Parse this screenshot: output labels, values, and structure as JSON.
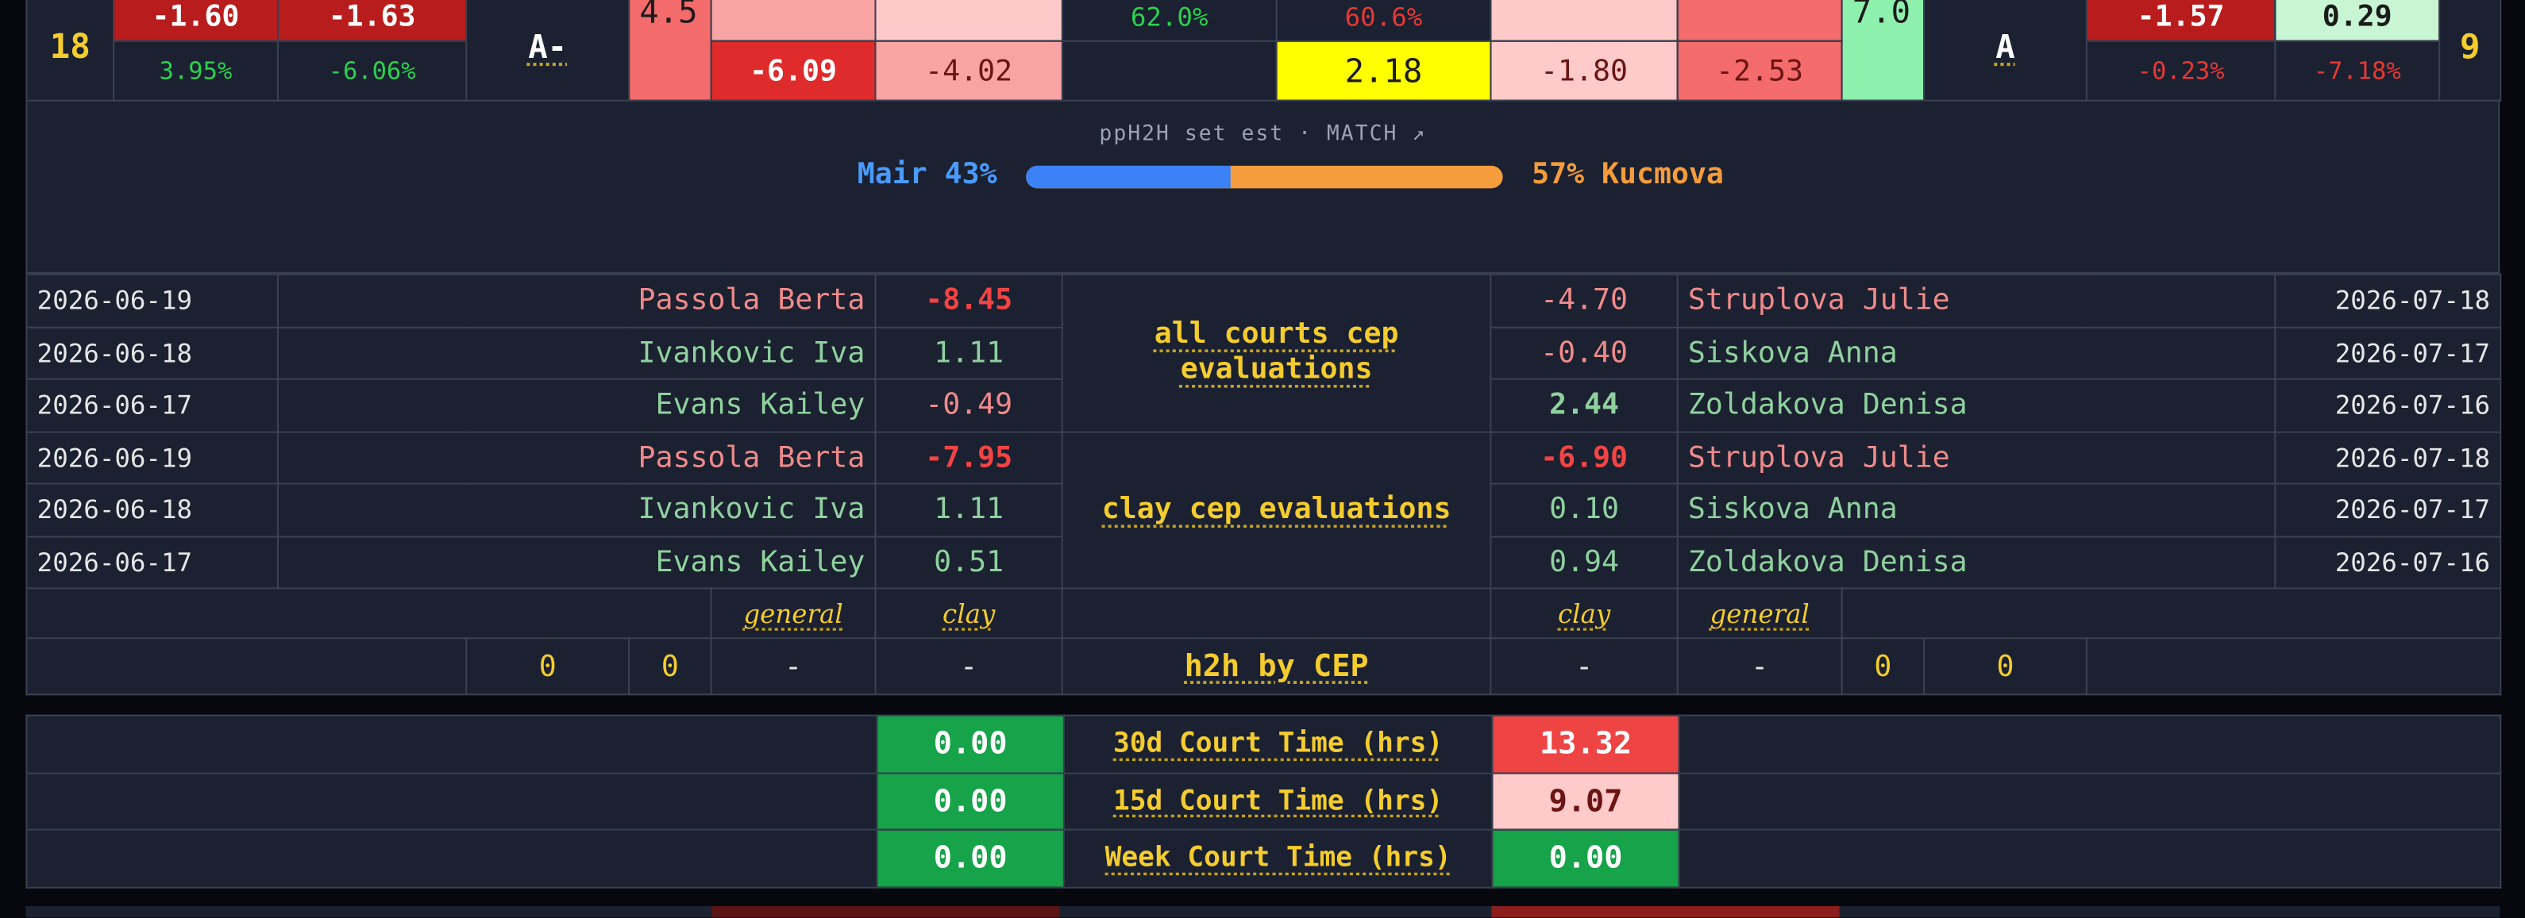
{
  "top": {
    "left_rank": "18",
    "left_vals": [
      "-1.60",
      "-1.63"
    ],
    "left_pcts": [
      "3.95%",
      "-6.06%"
    ],
    "left_grade": "A-",
    "left_score": "4.5",
    "mid_left_vals": [
      "-6.09",
      "-4.02"
    ],
    "center_pct_left": "62.0%",
    "center_pct_right": "60.6%",
    "center_big": "2.18",
    "mid_right_vals": [
      "-1.80",
      "-2.53"
    ],
    "right_score": "7.0",
    "right_grade": "A",
    "right_vals": [
      "-1.57",
      "0.29"
    ],
    "right_pcts": [
      "-0.23%",
      "-7.18%"
    ],
    "right_rank": "9"
  },
  "match": {
    "header": "ppH2H set est · MATCH ↗",
    "left_label": "Mair 43%",
    "right_label": "57% Kucmova",
    "left_prob": 0.43
  },
  "evals": {
    "all_label": "all courts cep evaluations",
    "clay_label": "clay cep evaluations",
    "rows": [
      {
        "ldate": "2026-06-19",
        "lname": "Passola Berta",
        "lval": "-8.45",
        "rval": "-4.70",
        "rname": "Struplova Julie",
        "rdate": "2026-07-18"
      },
      {
        "ldate": "2026-06-18",
        "lname": "Ivankovic Iva",
        "lval": "1.11",
        "rval": "-0.40",
        "rname": "Siskova Anna",
        "rdate": "2026-07-17"
      },
      {
        "ldate": "2026-06-17",
        "lname": "Evans Kailey",
        "lval": "-0.49",
        "rval": "2.44",
        "rname": "Zoldakova Denisa",
        "rdate": "2026-07-16"
      },
      {
        "ldate": "2026-06-19",
        "lname": "Passola Berta",
        "lval": "-7.95",
        "rval": "-6.90",
        "rname": "Struplova Julie",
        "rdate": "2026-07-18"
      },
      {
        "ldate": "2026-06-18",
        "lname": "Ivankovic Iva",
        "lval": "1.11",
        "rval": "0.10",
        "rname": "Siskova Anna",
        "rdate": "2026-07-17"
      },
      {
        "ldate": "2026-06-17",
        "lname": "Evans Kailey",
        "lval": "0.51",
        "rval": "0.94",
        "rname": "Zoldakova Denisa",
        "rdate": "2026-07-16"
      }
    ]
  },
  "h2h": {
    "general": "general",
    "clay": "clay",
    "label": "h2h by CEP",
    "left_counts": [
      "0",
      "0"
    ],
    "left_vals": [
      "-",
      "-"
    ],
    "right_vals": [
      "-",
      "-"
    ],
    "right_counts": [
      "0",
      "0"
    ]
  },
  "court": {
    "rows": [
      {
        "label": "30d Court Time (hrs)",
        "left": "0.00",
        "right": "13.32"
      },
      {
        "label": "15d Court Time (hrs)",
        "left": "0.00",
        "right": "9.07"
      },
      {
        "label": "Week Court Time (hrs)",
        "left": "0.00",
        "right": "0.00"
      }
    ]
  },
  "colors": {
    "accent": "#f5cc2e",
    "left_player": "#4a9bff",
    "right_player": "#f59c3c",
    "panel": "#1b2130"
  }
}
